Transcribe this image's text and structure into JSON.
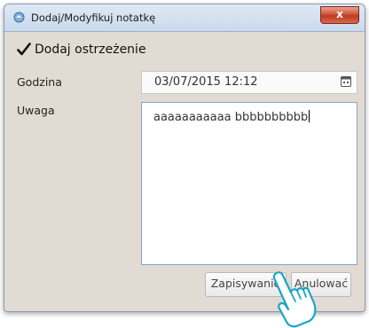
{
  "window": {
    "title": "Dodaj/Modyfikuj notatkę",
    "close_glyph": "x"
  },
  "form": {
    "add_warning_label": "Dodaj ostrzeżenie",
    "add_warning_checked": true,
    "time_label": "Godzina",
    "time_value": "03/07/2015 12:12",
    "note_label": "Uwaga",
    "note_value": "aaaaaaaaaaa bbbbbbbbbb"
  },
  "buttons": {
    "save_label": "Zapisywanie",
    "cancel_label": "Anulować"
  },
  "icons": [
    "app-icon",
    "close-icon",
    "checkmark-icon",
    "calendar-icon",
    "hand-pointer-icon"
  ]
}
